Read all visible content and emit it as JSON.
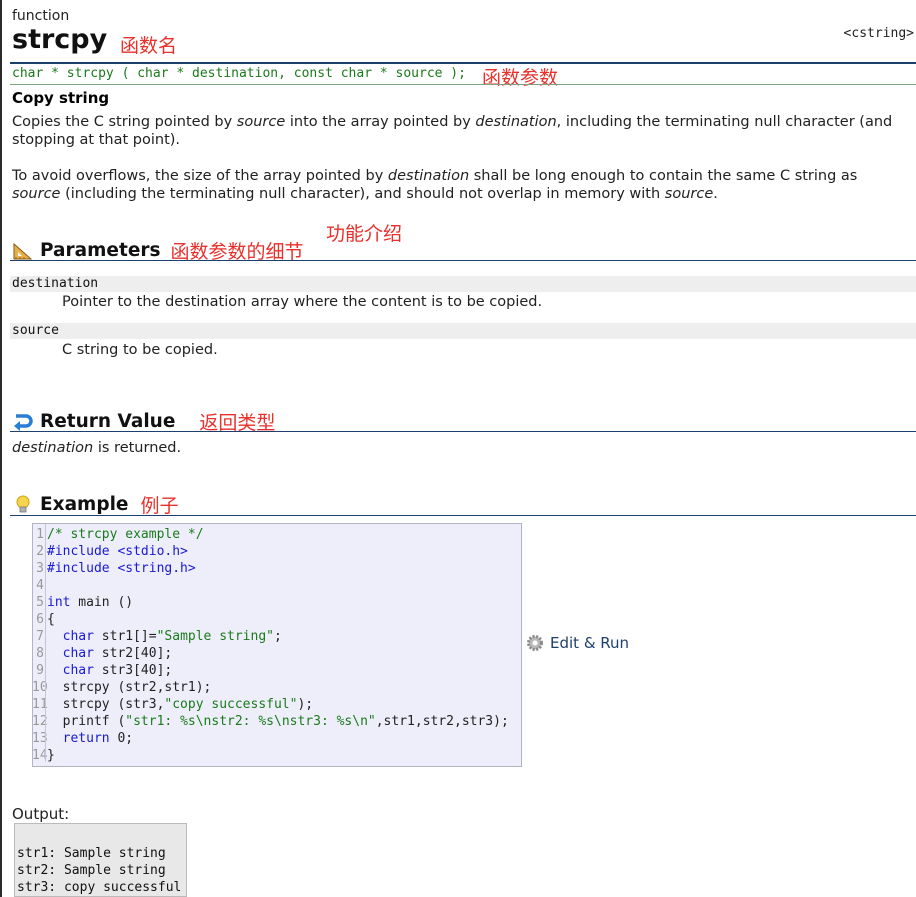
{
  "header": {
    "kind": "function",
    "name": "strcpy",
    "name_annotation": "函数名",
    "header_ref": "<cstring>"
  },
  "prototype": {
    "signature": "char * strcpy ( char * destination, const char * source );",
    "annotation": "函数参数"
  },
  "summary": {
    "heading": "Copy string",
    "para1": [
      {
        "t": "Copies the C string pointed by ",
        "i": false
      },
      {
        "t": "source",
        "i": true
      },
      {
        "t": " into the array pointed by ",
        "i": false
      },
      {
        "t": "destination",
        "i": true
      },
      {
        "t": ", including the terminating null character (and stopping at that point).",
        "i": false
      }
    ],
    "para2": [
      {
        "t": "To avoid overflows, the size of the array pointed by ",
        "i": false
      },
      {
        "t": "destination",
        "i": true
      },
      {
        "t": " shall be long enough to contain the same C string as ",
        "i": false
      },
      {
        "t": "source",
        "i": true
      },
      {
        "t": " (including the terminating null character), and should not overlap in memory with ",
        "i": false
      },
      {
        "t": "source",
        "i": true
      },
      {
        "t": ".",
        "i": false
      }
    ],
    "annotation": "功能介绍"
  },
  "parameters": {
    "heading": "Parameters",
    "annotation": "函数参数的细节",
    "items": [
      {
        "name": "destination",
        "desc": "Pointer to the destination array where the content is to be copied."
      },
      {
        "name": "source",
        "desc": "C string to be copied."
      }
    ]
  },
  "return_value": {
    "heading": "Return Value",
    "annotation": "返回类型",
    "text_em": "destination",
    "text_rest": " is returned."
  },
  "example": {
    "heading": "Example",
    "annotation": "例子",
    "line_numbers": [
      "1",
      "2",
      "3",
      "4",
      "5",
      "6",
      "7",
      "8",
      "9",
      "10",
      "11",
      "12",
      "13",
      "14"
    ],
    "code_lines": [
      [
        {
          "c": "cm",
          "t": "/* strcpy example */"
        }
      ],
      [
        {
          "c": "pp",
          "t": "#include <stdio.h>"
        }
      ],
      [
        {
          "c": "pp",
          "t": "#include <string.h>"
        }
      ],
      [
        {
          "c": "",
          "t": ""
        }
      ],
      [
        {
          "c": "kw",
          "t": "int"
        },
        {
          "c": "",
          "t": " main ()"
        }
      ],
      [
        {
          "c": "",
          "t": "{"
        }
      ],
      [
        {
          "c": "",
          "t": "  "
        },
        {
          "c": "kw",
          "t": "char"
        },
        {
          "c": "",
          "t": " str1[]="
        },
        {
          "c": "st",
          "t": "\"Sample string\""
        },
        {
          "c": "",
          "t": ";"
        }
      ],
      [
        {
          "c": "",
          "t": "  "
        },
        {
          "c": "kw",
          "t": "char"
        },
        {
          "c": "",
          "t": " str2[40];"
        }
      ],
      [
        {
          "c": "",
          "t": "  "
        },
        {
          "c": "kw",
          "t": "char"
        },
        {
          "c": "",
          "t": " str3[40];"
        }
      ],
      [
        {
          "c": "",
          "t": "  strcpy (str2,str1);"
        }
      ],
      [
        {
          "c": "",
          "t": "  strcpy (str3,"
        },
        {
          "c": "st",
          "t": "\"copy successful\""
        },
        {
          "c": "",
          "t": ");"
        }
      ],
      [
        {
          "c": "",
          "t": "  printf ("
        },
        {
          "c": "st",
          "t": "\"str1: %s\\nstr2: %s\\nstr3: %s\\n\""
        },
        {
          "c": "",
          "t": ",str1,str2,str3);"
        }
      ],
      [
        {
          "c": "",
          "t": "  "
        },
        {
          "c": "kw",
          "t": "return"
        },
        {
          "c": "",
          "t": " 0;"
        }
      ],
      [
        {
          "c": "",
          "t": "}"
        }
      ]
    ],
    "edit_run_label": "Edit & Run",
    "output_label": "Output:",
    "output_lines": [
      "str1: Sample string",
      "str2: Sample string",
      "str3: copy successful"
    ]
  },
  "icons": {
    "parameters": "ruler-triangle-icon",
    "return_value": "return-arrow-icon",
    "example": "lightbulb-icon",
    "edit_run": "gear-icon"
  },
  "colors": {
    "annotation": "#e8302c",
    "rule": "#1d3f6b",
    "prototype": "#1a7a1a",
    "code_bg": "#eeeefb"
  }
}
